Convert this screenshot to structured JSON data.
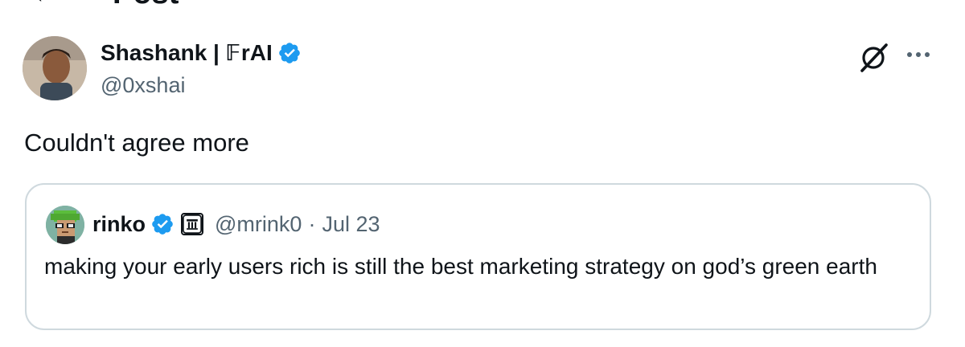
{
  "header": {
    "title": "Post"
  },
  "author": {
    "name": "Shashank | 𝔽rAI",
    "handle": "@0xshai",
    "avatar_icon": "user-avatar-photo",
    "verified_color": "#1d9bf0"
  },
  "tweet": {
    "text": "Couldn't agree more"
  },
  "quote": {
    "name": "rinko",
    "handle": "@mrink0",
    "separator": "·",
    "date": "Jul 23",
    "text": "making your early users rich is still the best marketing strategy on god’s green earth",
    "avatar_icon": "pixel-avatar"
  },
  "icons": {
    "grok": "grok-icon",
    "more": "more-options-icon",
    "verified": "verified-badge-icon",
    "affiliation": "affiliation-badge-icon"
  },
  "colors": {
    "text_primary": "#0f1419",
    "text_secondary": "#536471",
    "border": "#cfd9de",
    "accent": "#1d9bf0"
  }
}
